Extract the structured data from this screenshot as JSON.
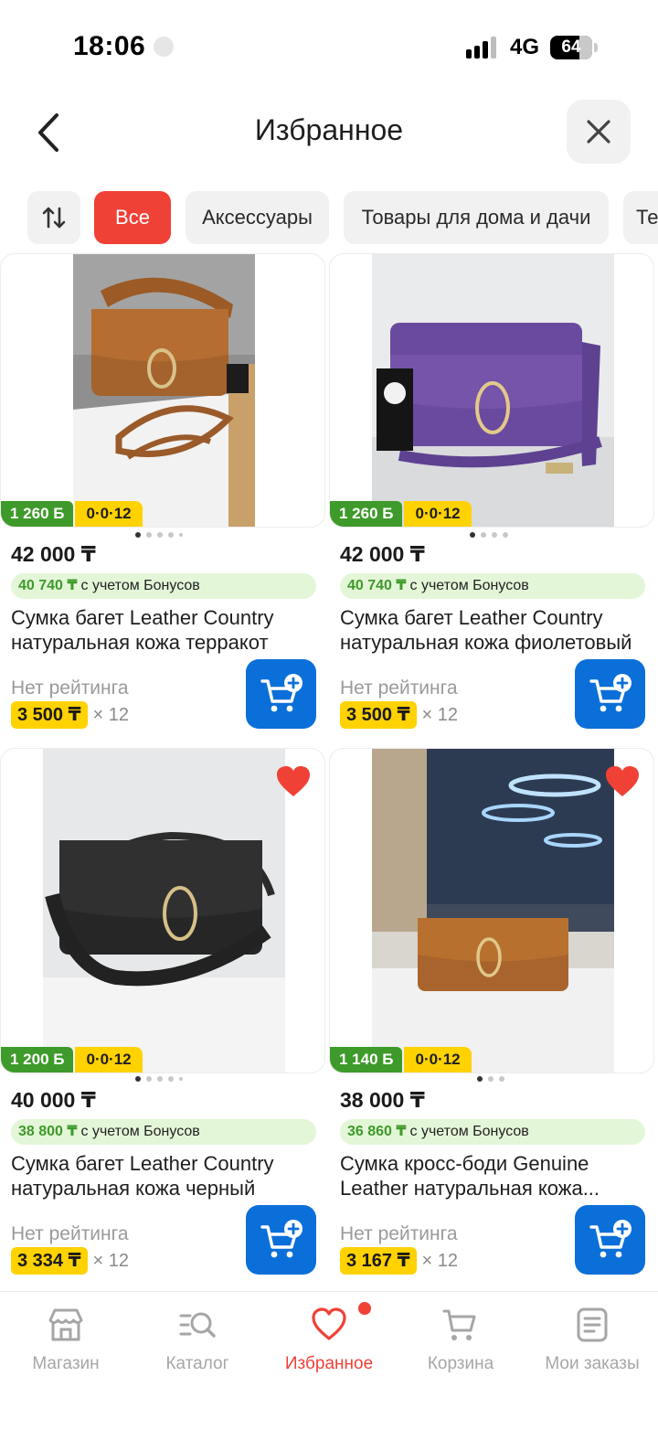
{
  "status_bar": {
    "time": "18:06",
    "network": "4G",
    "battery": "64"
  },
  "header": {
    "title": "Избранное"
  },
  "filters": [
    {
      "label": "Все",
      "active": true
    },
    {
      "label": "Аксессуары",
      "active": false
    },
    {
      "label": "Товары для дома и дачи",
      "active": false
    },
    {
      "label": "Те",
      "active": false
    }
  ],
  "products": [
    {
      "bonus_badge": "1 260 Б",
      "installment_badge": "0·0·12",
      "favorite": false,
      "price": "42 000 ₸",
      "bonus_price": "40 740 ₸",
      "bonus_note": "с учетом Бонусов",
      "title_line1": "Сумка багет Leather Country",
      "title_line2": "натуральная кожа терракот",
      "rating": "Нет рейтинга",
      "installment_price": "3 500 ₸",
      "installment_months": "× 12",
      "color": "#a4622d"
    },
    {
      "bonus_badge": "1 260 Б",
      "installment_badge": "0·0·12",
      "favorite": false,
      "price": "42 000 ₸",
      "bonus_price": "40 740 ₸",
      "bonus_note": "с учетом Бонусов",
      "title_line1": "Сумка багет Leather Country",
      "title_line2": "натуральная кожа фиолетовый",
      "rating": "Нет рейтинга",
      "installment_price": "3 500 ₸",
      "installment_months": "× 12",
      "color": "#6a4a9e"
    },
    {
      "bonus_badge": "1 200 Б",
      "installment_badge": "0·0·12",
      "favorite": true,
      "price": "40 000 ₸",
      "bonus_price": "38 800 ₸",
      "bonus_note": "с учетом Бонусов",
      "title_line1": "Сумка багет Leather Country",
      "title_line2": "натуральная кожа черный",
      "rating": "Нет рейтинга",
      "installment_price": "3 334 ₸",
      "installment_months": "× 12",
      "color": "#262626"
    },
    {
      "bonus_badge": "1 140 Б",
      "installment_badge": "0·0·12",
      "favorite": true,
      "price": "38 000 ₸",
      "bonus_price": "36 860 ₸",
      "bonus_note": "с учетом Бонусов",
      "title_line1": "Сумка кросс-боди Genuine",
      "title_line2": "Leather натуральная кожа...",
      "rating": "Нет рейтинга",
      "installment_price": "3 167 ₸",
      "installment_months": "× 12",
      "color": "#a8642c"
    }
  ],
  "bottom_nav": [
    {
      "label": "Магазин",
      "icon": "store-icon",
      "active": false
    },
    {
      "label": "Каталог",
      "icon": "catalog-search-icon",
      "active": false
    },
    {
      "label": "Избранное",
      "icon": "heart-icon",
      "active": true
    },
    {
      "label": "Корзина",
      "icon": "cart-icon",
      "active": false
    },
    {
      "label": "Мои заказы",
      "icon": "orders-icon",
      "active": false
    }
  ],
  "colors": {
    "accent": "#f04137",
    "primary_button": "#0a6fd8",
    "bonus_green": "#3e9a2a",
    "installment_yellow": "#ffd200"
  }
}
